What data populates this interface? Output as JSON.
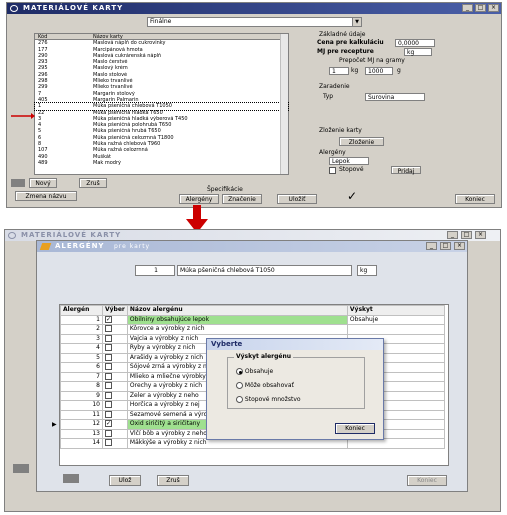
{
  "top": {
    "title": "MATERIÁLOVÉ KARTY",
    "dropdown_value": "Finálne",
    "list": {
      "header_code": "Kód",
      "header_name": "Názov karty",
      "rows": [
        [
          "276",
          "Maslová náplň do cukrovinky"
        ],
        [
          "177",
          "Marcipánová hmota"
        ],
        [
          "290",
          "Maslová cukrárenská náplň"
        ],
        [
          "293",
          "Maslo čerstvé"
        ],
        [
          "295",
          "Maslový krém"
        ],
        [
          "296",
          "Maslo stolové"
        ],
        [
          "298",
          "Mlieko trvanlivé"
        ],
        [
          "299",
          "Mlieko trvanlivé"
        ],
        [
          "7",
          "Margarín stolový"
        ],
        [
          "405",
          "Margarín Palmarin"
        ],
        [
          "1",
          "Múka pšeničná chlebová T1050"
        ],
        [
          "22",
          "Múka pšeničná hladká T650"
        ],
        [
          "3",
          "Múka pšeničná hladká výberová T450"
        ],
        [
          "4",
          "Múka pšeničná polohrubá T650"
        ],
        [
          "5",
          "Múka pšeničná hrubá T650"
        ],
        [
          "6",
          "Múka pšeničná celozrnná T1800"
        ],
        [
          "8",
          "Múka ražná chlebová T960"
        ],
        [
          "107",
          "Múka ražná celozrnná"
        ],
        [
          "490",
          "Muškát"
        ],
        [
          "489",
          "Mak modrý"
        ]
      ]
    },
    "right": {
      "section_basic": "Základné údaje",
      "calc_price_label": "Cena pre kalkuláciu",
      "calc_price_value": "0,0000",
      "unit_label": "MJ pre recepture",
      "unit_value": "kg",
      "conversion_label": "Prepočet MJ na gramy",
      "conv_qty": "1",
      "conv_unit": "kg",
      "conv_grams": "1000",
      "conv_g": "g",
      "section_allocation": "Zaradenie",
      "type_label": "Typ",
      "type_value": "Surovina",
      "section_ingredients": "Zloženie karty",
      "ingredients_button": "Zloženie",
      "section_allergens": "Alergény",
      "allergens_value": "Lepok",
      "trace_label": "Stopové",
      "add_label": "Pridaj"
    },
    "buttons": {
      "new": "Nový",
      "delete": "Zruš",
      "change_name": "Zmena názvu",
      "specs_label": "Špecifikácie",
      "allergens": "Alergény",
      "labeling": "Značenie",
      "ok": "Uložiť",
      "close": "Koniec"
    }
  },
  "bottom": {
    "outer_title": "MATERIÁLOVÉ KARTY",
    "inner_title": "ALERGÉNY",
    "inner_subtitle": "pre karty",
    "item_code": "1",
    "item_name": "Múka pšeničná chlebová T1050",
    "item_unit": "kg",
    "table": {
      "headers": [
        "Alergén",
        "Výber",
        "Názov alergénu",
        "Výskyt"
      ],
      "rows": [
        {
          "num": "1",
          "checked": true,
          "name": "Obilniny obsahujúce lepok",
          "occ": "Obsahuje",
          "highlight": true
        },
        {
          "num": "2",
          "checked": false,
          "name": "Kôrovce a výrobky z nich",
          "occ": ""
        },
        {
          "num": "3",
          "checked": false,
          "name": "Vajcia a výrobky z nich",
          "occ": ""
        },
        {
          "num": "4",
          "checked": false,
          "name": "Ryby a výrobky z nich",
          "occ": ""
        },
        {
          "num": "5",
          "checked": false,
          "name": "Arašidy a výrobky z nich",
          "occ": ""
        },
        {
          "num": "6",
          "checked": false,
          "name": "Sójové zrná a výrobky z nich",
          "occ": ""
        },
        {
          "num": "7",
          "checked": false,
          "name": "Mlieko a mliečne výrobky",
          "occ": ""
        },
        {
          "num": "8",
          "checked": false,
          "name": "Orechy a výrobky z nich",
          "occ": ""
        },
        {
          "num": "9",
          "checked": false,
          "name": "Zeler a výrobky z neho",
          "occ": ""
        },
        {
          "num": "10",
          "checked": false,
          "name": "Horčica a výrobky z nej",
          "occ": ""
        },
        {
          "num": "11",
          "checked": false,
          "name": "Sezamové semená a výrobky z nich",
          "occ": ""
        },
        {
          "num": "12",
          "checked": true,
          "name": "Oxid siričitý a siričitany",
          "occ": "",
          "highlight": true
        },
        {
          "num": "13",
          "checked": false,
          "name": "Vlčí bôb a výrobky z neho",
          "occ": ""
        },
        {
          "num": "14",
          "checked": false,
          "name": "Mäkkýše a výrobky z nich",
          "occ": ""
        }
      ]
    },
    "dialog": {
      "title": "Vyberte",
      "group_label": "Výskyt alergénu",
      "options": [
        "Obsahuje",
        "Môže obsahovať",
        "Stopové množstvo"
      ],
      "selected": 0,
      "close_button": "Koniec"
    },
    "buttons": {
      "save": "Ulož",
      "cancel": "Zruš",
      "close": "Koniec"
    }
  },
  "colors": {
    "title_dark": "#1e2b66",
    "title_inner": "#a9b8d6",
    "highlight_row": "#9fe08f",
    "arrow": "#cc0000"
  }
}
